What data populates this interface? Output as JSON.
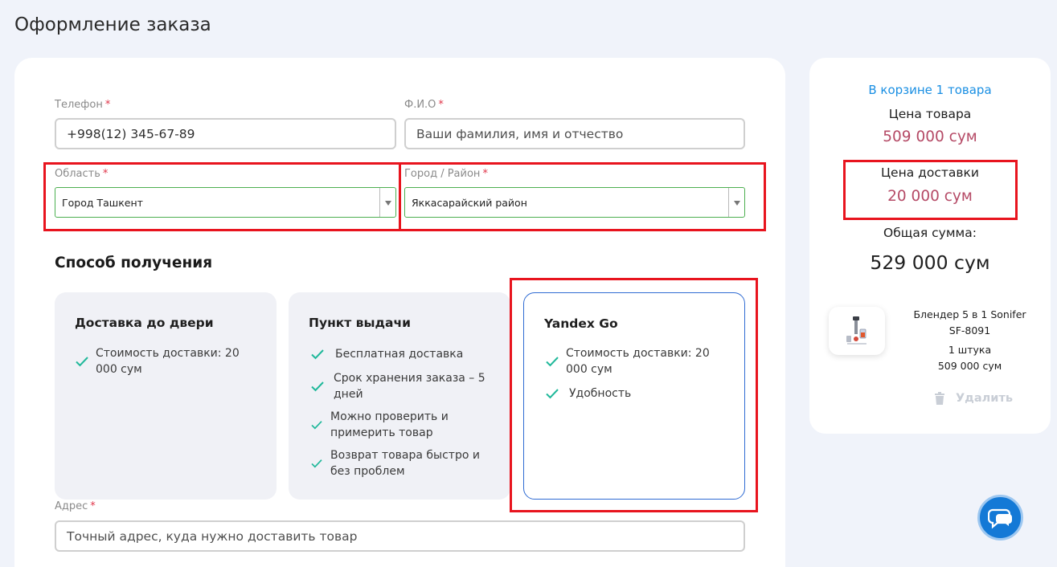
{
  "page": {
    "title": "Оформление заказа"
  },
  "form": {
    "phone": {
      "label": "Телефон",
      "required_mark": "*",
      "value": "+998(12) 345-67-89"
    },
    "fio": {
      "label": "Ф.И.О",
      "required_mark": "*",
      "placeholder": "Ваши фамилия, имя и отчество"
    },
    "region": {
      "label": "Область",
      "required_mark": "*",
      "value": "Город Ташкент"
    },
    "city": {
      "label": "Город / Район",
      "required_mark": "*",
      "value": "Яккасарайский район"
    },
    "address": {
      "label": "Адрес",
      "required_mark": "*",
      "placeholder": "Точный адрес, куда нужно доставить товар"
    }
  },
  "delivery": {
    "section_title": "Способ получения",
    "methods": [
      {
        "title": "Доставка до двери",
        "features": [
          "Стоимость доставки: 20 000 сум"
        ]
      },
      {
        "title": "Пункт выдачи",
        "features": [
          "Бесплатная доставка",
          "Срок хранения заказа – 5 дней",
          "Можно проверить и примерить товар",
          "Возврат товара быстро и без проблем"
        ]
      },
      {
        "title": "Yandex Go",
        "features": [
          "Стоимость доставки: 20 000 сум",
          "Удобность"
        ],
        "selected": true
      }
    ]
  },
  "summary": {
    "cart_count": "В корзине 1 товара",
    "item_price_label": "Цена товара",
    "item_price": "509 000 сум",
    "delivery_price_label": "Цена доставки",
    "delivery_price": "20 000 сум",
    "total_label": "Общая сумма:",
    "total": "529 000 сум",
    "product": {
      "name_line1": "Блендер 5 в 1 Sonifer",
      "name_line2": "SF-8091",
      "quantity": "1 штука",
      "price": "509 000 сум"
    },
    "delete_label": "Удалить"
  },
  "colors": {
    "accent_blue": "#1a8fe3",
    "price_color": "#b54a66",
    "check_green": "#1fb89a",
    "highlight_red": "#e8141e"
  }
}
